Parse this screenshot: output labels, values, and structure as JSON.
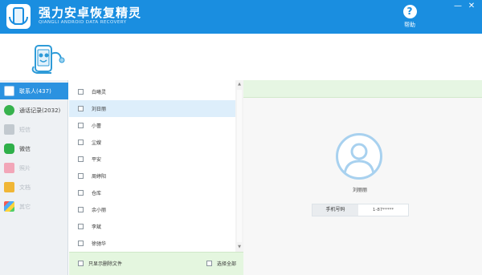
{
  "app": {
    "title": "强力安卓恢复精灵",
    "subtitle": "QIANGLI ANDROID DATA RECOVERY",
    "help_label": "帮助",
    "minimize_glyph": "—",
    "close_glyph": "✕",
    "logo_icon": "phone-recovery-logo",
    "mascot_icon": "phone-mascot-icon"
  },
  "sidebar": {
    "items": [
      {
        "label": "联系人(437)",
        "icon": "contacts-icon",
        "state": "active"
      },
      {
        "label": "通话记录(2032)",
        "icon": "call-log-icon",
        "state": "normal"
      },
      {
        "label": "短信",
        "icon": "sms-icon",
        "state": "disabled"
      },
      {
        "label": "微信",
        "icon": "wechat-icon",
        "state": "normal"
      },
      {
        "label": "照片",
        "icon": "photos-icon",
        "state": "disabled"
      },
      {
        "label": "文档",
        "icon": "documents-icon",
        "state": "disabled"
      },
      {
        "label": "其它",
        "icon": "other-icon",
        "state": "disabled"
      }
    ]
  },
  "contact_list": {
    "items": [
      {
        "name": "白曦灵",
        "checked": false,
        "selected": false
      },
      {
        "name": "刘日丽",
        "checked": false,
        "selected": true
      },
      {
        "name": "小蕾",
        "checked": false,
        "selected": false
      },
      {
        "name": "尘嫂",
        "checked": false,
        "selected": false
      },
      {
        "name": "平安",
        "checked": false,
        "selected": false
      },
      {
        "name": "周婷阳",
        "checked": false,
        "selected": false
      },
      {
        "name": "仓库",
        "checked": false,
        "selected": false
      },
      {
        "name": "余小丽",
        "checked": false,
        "selected": false
      },
      {
        "name": "李斌",
        "checked": false,
        "selected": false
      },
      {
        "name": "徐驰华",
        "checked": false,
        "selected": false
      }
    ],
    "footer": {
      "show_deleted_label": "只显示删除文件",
      "select_all_label": "选择全部"
    },
    "scroll_up_glyph": "▲",
    "scroll_down_glyph": "▼"
  },
  "detail": {
    "contact_name": "刘丽丽",
    "phone_label": "手机号码",
    "phone_value": "1-87*****",
    "avatar_icon": "contact-avatar-icon"
  },
  "colors": {
    "accent": "#1a8ee0",
    "sidebar_active": "#2b92e0",
    "footer_green": "#e4f6df"
  }
}
